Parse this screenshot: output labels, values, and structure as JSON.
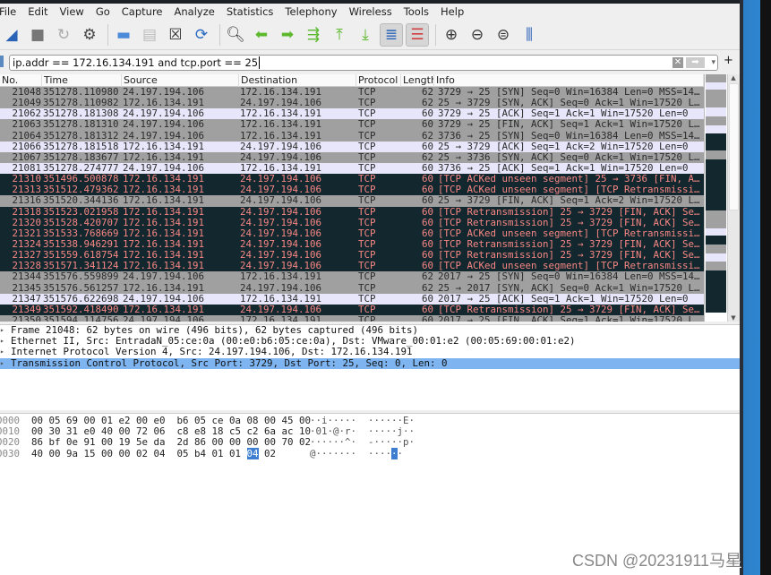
{
  "colors": {
    "gray_row": "#a0a0a0",
    "lavender_row": "#e7e6fa",
    "dark_row": "#12272e",
    "dark_row_text": "#f78784",
    "selected_detail": "#7eb5f1"
  },
  "menu": [
    "File",
    "Edit",
    "View",
    "Go",
    "Capture",
    "Analyze",
    "Statistics",
    "Telephony",
    "Wireless",
    "Tools",
    "Help"
  ],
  "toolbar": [
    "shark-fin-start-icon",
    "stop-icon",
    "restart-icon",
    "options-gear-icon",
    "open-folder-icon",
    "save-file-icon",
    "close-file-icon",
    "reload-icon",
    "find-icon",
    "back-arrow-icon",
    "forward-arrow-icon",
    "goto-packet-icon",
    "first-packet-icon",
    "last-packet-icon",
    "autoscroll-icon",
    "colorize-icon",
    "zoom-in-icon",
    "zoom-out-icon",
    "zoom-normal-icon",
    "resize-columns-icon"
  ],
  "filter": {
    "value": "ip.addr == 172.16.134.191 and tcp.port == 25",
    "plus": "+"
  },
  "columns": [
    "No.",
    "Time",
    "Source",
    "Destination",
    "Protocol",
    "Length",
    "Info"
  ],
  "packets": [
    {
      "no": "21048",
      "time": "351278.110980",
      "src": "24.197.194.106",
      "dst": "172.16.134.191",
      "proto": "TCP",
      "len": "62",
      "info": "3729 → 25 [SYN] Seq=0 Win=16384 Len=0 MSS=1460…",
      "style": "gray"
    },
    {
      "no": "21049",
      "time": "351278.110982",
      "src": "172.16.134.191",
      "dst": "24.197.194.106",
      "proto": "TCP",
      "len": "62",
      "info": "25 → 3729 [SYN, ACK] Seq=0 Ack=1 Win=17520 Len…",
      "style": "gray"
    },
    {
      "no": "21062",
      "time": "351278.181308",
      "src": "24.197.194.106",
      "dst": "172.16.134.191",
      "proto": "TCP",
      "len": "60",
      "info": "3729 → 25 [ACK] Seq=1 Ack=1 Win=17520 Len=0",
      "style": "lav"
    },
    {
      "no": "21063",
      "time": "351278.181310",
      "src": "24.197.194.106",
      "dst": "172.16.134.191",
      "proto": "TCP",
      "len": "60",
      "info": "3729 → 25 [FIN, ACK] Seq=1 Ack=1 Win=17520 Len…",
      "style": "gray"
    },
    {
      "no": "21064",
      "time": "351278.181312",
      "src": "24.197.194.106",
      "dst": "172.16.134.191",
      "proto": "TCP",
      "len": "62",
      "info": "3736 → 25 [SYN] Seq=0 Win=16384 Len=0 MSS=1460…",
      "style": "gray"
    },
    {
      "no": "21066",
      "time": "351278.181518",
      "src": "172.16.134.191",
      "dst": "24.197.194.106",
      "proto": "TCP",
      "len": "60",
      "info": "25 → 3729 [ACK] Seq=1 Ack=2 Win=17520 Len=0",
      "style": "lav"
    },
    {
      "no": "21067",
      "time": "351278.183677",
      "src": "172.16.134.191",
      "dst": "24.197.194.106",
      "proto": "TCP",
      "len": "62",
      "info": "25 → 3736 [SYN, ACK] Seq=0 Ack=1 Win=17520 Len…",
      "style": "gray"
    },
    {
      "no": "21081",
      "time": "351278.274777",
      "src": "24.197.194.106",
      "dst": "172.16.134.191",
      "proto": "TCP",
      "len": "60",
      "info": "3736 → 25 [ACK] Seq=1 Ack=1 Win=17520 Len=0",
      "style": "lav"
    },
    {
      "no": "21310",
      "time": "351496.500878",
      "src": "172.16.134.191",
      "dst": "24.197.194.106",
      "proto": "TCP",
      "len": "60",
      "info": "[TCP ACKed unseen segment] 25 → 3736 [FIN, ACK…",
      "style": "dark"
    },
    {
      "no": "21313",
      "time": "351512.479362",
      "src": "172.16.134.191",
      "dst": "24.197.194.106",
      "proto": "TCP",
      "len": "60",
      "info": "[TCP ACKed unseen segment] [TCP Retransmission…",
      "style": "dark"
    },
    {
      "no": "21316",
      "time": "351520.344136",
      "src": "172.16.134.191",
      "dst": "24.197.194.106",
      "proto": "TCP",
      "len": "60",
      "info": "25 → 3729 [FIN, ACK] Seq=1 Ack=2 Win=17520 Len…",
      "style": "gray"
    },
    {
      "no": "21318",
      "time": "351523.021958",
      "src": "172.16.134.191",
      "dst": "24.197.194.106",
      "proto": "TCP",
      "len": "60",
      "info": "[TCP Retransmission] 25 → 3729 [FIN, ACK] Seq=…",
      "style": "dark"
    },
    {
      "no": "21320",
      "time": "351528.420707",
      "src": "172.16.134.191",
      "dst": "24.197.194.106",
      "proto": "TCP",
      "len": "60",
      "info": "[TCP Retransmission] 25 → 3729 [FIN, ACK] Seq=…",
      "style": "dark"
    },
    {
      "no": "21321",
      "time": "351533.768669",
      "src": "172.16.134.191",
      "dst": "24.197.194.106",
      "proto": "TCP",
      "len": "60",
      "info": "[TCP ACKed unseen segment] [TCP Retransmission…",
      "style": "dark"
    },
    {
      "no": "21324",
      "time": "351538.946291",
      "src": "172.16.134.191",
      "dst": "24.197.194.106",
      "proto": "TCP",
      "len": "60",
      "info": "[TCP Retransmission] 25 → 3729 [FIN, ACK] Seq=…",
      "style": "dark"
    },
    {
      "no": "21327",
      "time": "351559.618754",
      "src": "172.16.134.191",
      "dst": "24.197.194.106",
      "proto": "TCP",
      "len": "60",
      "info": "[TCP Retransmission] 25 → 3729 [FIN, ACK] Seq=…",
      "style": "dark"
    },
    {
      "no": "21328",
      "time": "351571.341124",
      "src": "172.16.134.191",
      "dst": "24.197.194.106",
      "proto": "TCP",
      "len": "60",
      "info": "[TCP ACKed unseen segment] [TCP Retransmission…",
      "style": "dark"
    },
    {
      "no": "21344",
      "time": "351576.559899",
      "src": "24.197.194.106",
      "dst": "172.16.134.191",
      "proto": "TCP",
      "len": "62",
      "info": "2017 → 25 [SYN] Seq=0 Win=16384 Len=0 MSS=1460…",
      "style": "gray"
    },
    {
      "no": "21345",
      "time": "351576.561257",
      "src": "172.16.134.191",
      "dst": "24.197.194.106",
      "proto": "TCP",
      "len": "62",
      "info": "25 → 2017 [SYN, ACK] Seq=0 Ack=1 Win=17520 Len…",
      "style": "gray"
    },
    {
      "no": "21347",
      "time": "351576.622698",
      "src": "24.197.194.106",
      "dst": "172.16.134.191",
      "proto": "TCP",
      "len": "60",
      "info": "2017 → 25 [ACK] Seq=1 Ack=1 Win=17520 Len=0",
      "style": "lav"
    },
    {
      "no": "21349",
      "time": "351592.418490",
      "src": "172.16.134.191",
      "dst": "24.197.194.106",
      "proto": "TCP",
      "len": "60",
      "info": "[TCP Retransmission] 25 → 3729 [FIN, ACK] Seq=…",
      "style": "dark"
    },
    {
      "no": "21350",
      "time": "351594.114756",
      "src": "24.197.194.106",
      "dst": "172.16.134.191",
      "proto": "TCP",
      "len": "60",
      "info": "2017 → 25 [FIN, ACK] Seq=1 Ack=1 Win=17520 Len…",
      "style": "gray"
    }
  ],
  "details": [
    "Frame 21048: 62 bytes on wire (496 bits), 62 bytes captured (496 bits)",
    "Ethernet II, Src: EntradaN_05:ce:0a (00:e0:b6:05:ce:0a), Dst: VMware_00:01:e2 (00:05:69:00:01:e2)",
    "Internet Protocol Version 4, Src: 24.197.194.106, Dst: 172.16.134.191",
    "Transmission Control Protocol, Src Port: 3729, Dst Port: 25, Seq: 0, Len: 0"
  ],
  "hex": [
    {
      "off": "0000",
      "a": "00 05 69 00 01 e2 00 e0  b6 05 ce 0a 08 00 45 00",
      "hl": "",
      "b": "",
      "asc": "··i·····  ······E·"
    },
    {
      "off": "0010",
      "a": "00 30 31 e0 40 00 72 06  c8 e8 18 c5 c2 6a ac 10",
      "hl": "",
      "b": "",
      "asc": "·01·@·r·  ·····j··"
    },
    {
      "off": "0020",
      "a": "86 bf 0e 91 00 19 5e da  2d 86 00 00 00 00 70 02",
      "hl": "",
      "b": "",
      "asc": "······^·  -·····p·"
    },
    {
      "off": "0030",
      "a": "40 00 9a 15 00 00 02 04  05 b4 01 01 ",
      "hl": "04",
      "b": " 02",
      "asc": "@·······  ····",
      "asc_hl": "·",
      "asc_b": "·"
    }
  ],
  "watermark": "CSDN @20231911马星"
}
